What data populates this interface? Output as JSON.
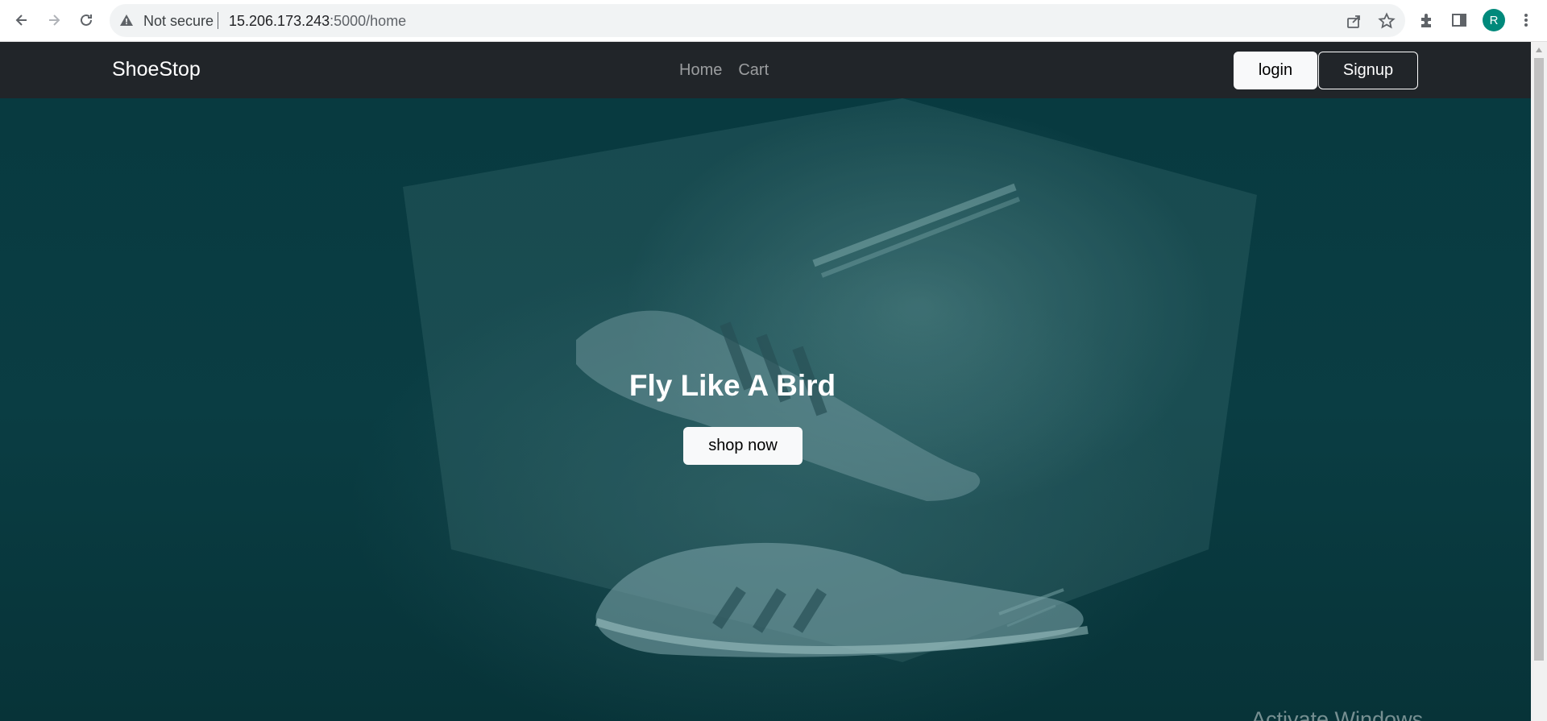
{
  "browser": {
    "security_label": "Not secure",
    "url_host": "15.206.173.243",
    "url_path": ":5000/home",
    "profile_initial": "R",
    "profile_color": "#00897b"
  },
  "site": {
    "brand": "ShoeStop",
    "nav_links": [
      "Home",
      "Cart"
    ],
    "login_label": "login",
    "signup_label": "Signup",
    "navbar_color": "#212529"
  },
  "hero": {
    "title": "Fly Like A Bird",
    "cta_label": "shop now",
    "background_tint": "#0a3d43"
  },
  "os": {
    "watermark": "Activate Windows"
  }
}
